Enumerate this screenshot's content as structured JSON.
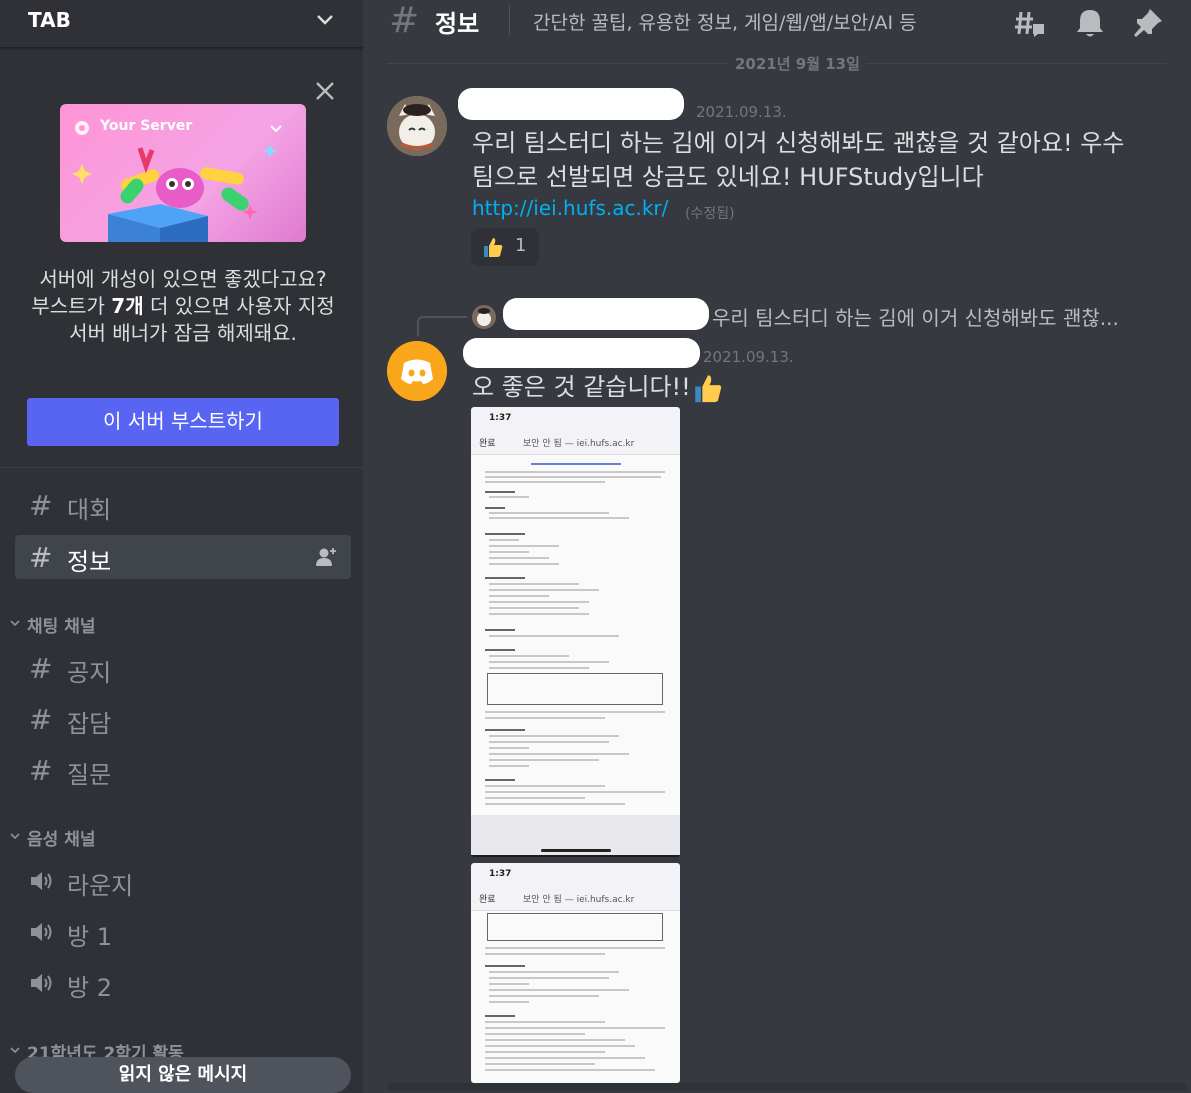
{
  "server": {
    "name": "TAB"
  },
  "boost": {
    "banner_title": "Your Server",
    "text_part1": "서버에 개성이 있으면 좋겠다고요? 부스트가 ",
    "text_bold": "7개",
    "text_part2": " 더 있으면 사용자 지정 서버 배너가 잠금 해제돼요.",
    "button_label": "이 서버 부스트하기"
  },
  "sidebar": {
    "top_channels": [
      {
        "name": "대회"
      },
      {
        "name": "정보"
      }
    ],
    "categories": [
      {
        "name": "채팅 채널",
        "channels": [
          {
            "name": "공지"
          },
          {
            "name": "잡담"
          },
          {
            "name": "질문"
          }
        ]
      },
      {
        "name": "음성 채널",
        "channels": [
          {
            "name": "라운지"
          },
          {
            "name": "방 1"
          },
          {
            "name": "방 2"
          }
        ]
      },
      {
        "name": "21학년도 2학기 활동",
        "channels": []
      }
    ],
    "unread_label": "읽지 않은 메시지"
  },
  "channel": {
    "name": "정보",
    "topic": "간단한 꿀팁, 유용한 정보, 게임/웹/앱/보안/AI 등"
  },
  "date_divider": "2021년 9월 13일",
  "messages": [
    {
      "timestamp": "2021.09.13.",
      "text_line1": "우리 팀스터디 하는 김에 이거 신청해봐도 괜찮을 것 같아요! 우수",
      "text_line2": "팀으로 선발되면 상금도 있네요! HUFStudy입니다",
      "link": "http://iei.hufs.ac.kr/",
      "edited": "(수정됨)",
      "reaction": {
        "emoji": "thumbs-up",
        "count": "1"
      }
    },
    {
      "reply_preview": "우리 팀스터디 하는 김에 이거 신청해봐도 괜찮...",
      "timestamp": "2021.09.13.",
      "text": "오 좋은 것 같습니다!!"
    }
  ],
  "attachments": [
    {
      "time": "1:37",
      "done": "완료",
      "url": "보안 안 됨 — iei.hufs.ac.kr"
    },
    {
      "time": "1:37",
      "done": "완료",
      "url": "보안 안 됨 — iei.hufs.ac.kr"
    }
  ],
  "colors": {
    "blurple": "#5865f2",
    "link": "#00aff4",
    "sidebar": "#2f3136",
    "main": "#36393f"
  }
}
